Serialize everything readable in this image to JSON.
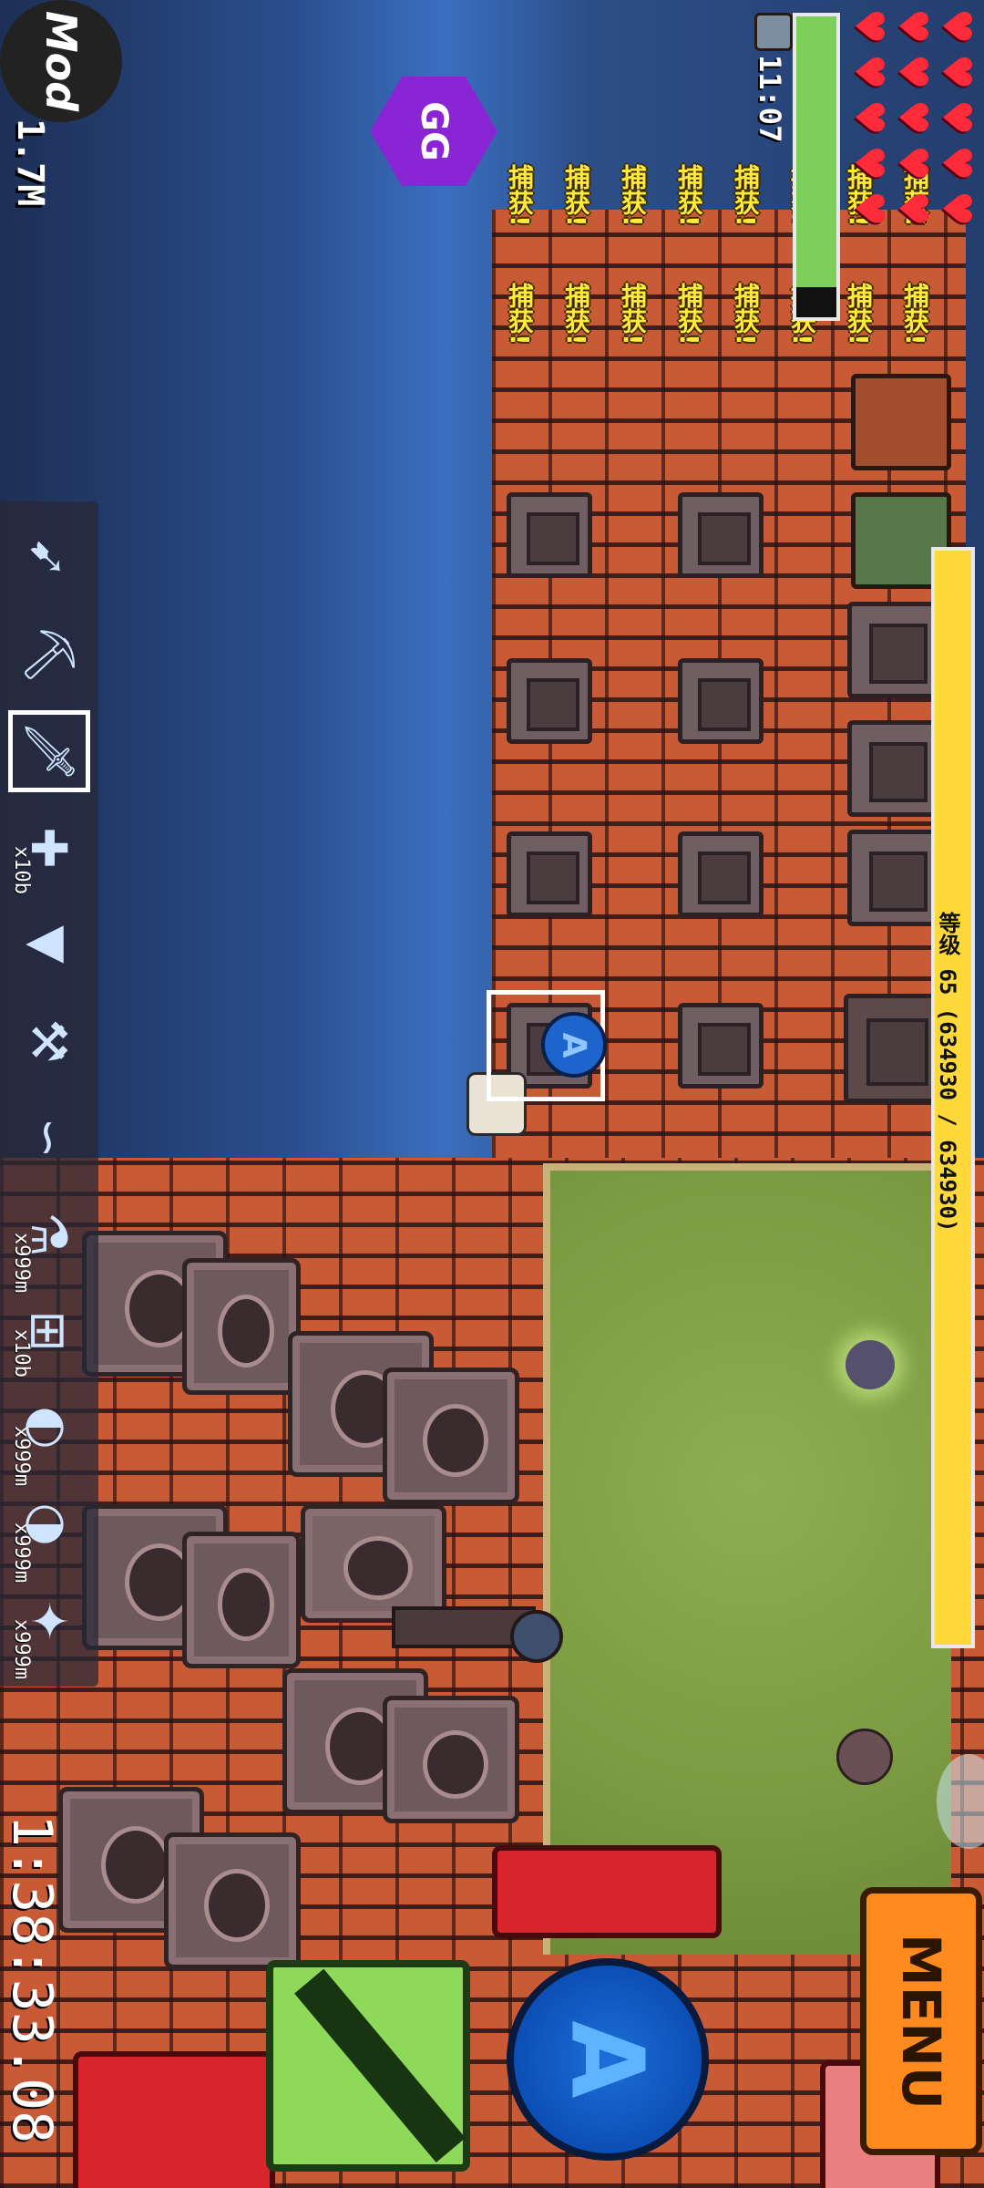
{
  "hud": {
    "mod_badge": "Mod",
    "money": "1.7M",
    "clock": "11:07",
    "timer": "1:38:33.08",
    "level_text": "等级 65 (634930 / 634930)",
    "hp_fraction": 0.9,
    "level_fraction": 1.0
  },
  "hearts": {
    "count": 15,
    "symbol": "♥"
  },
  "notices": {
    "text": "捕获!",
    "columns": [
      {
        "items": [
          "捕获!",
          "捕获!"
        ]
      },
      {
        "items": [
          "捕获!",
          "捕获!"
        ]
      },
      {
        "items": [
          "捕获!",
          "捕获!"
        ]
      },
      {
        "items": [
          "捕获!",
          "捕获!"
        ]
      },
      {
        "items": [
          "捕获!",
          "捕获!"
        ]
      },
      {
        "items": [
          "捕获!",
          "捕获!"
        ]
      },
      {
        "items": [
          "捕获!",
          "捕获!"
        ]
      },
      {
        "items": [
          "捕获!",
          "捕获!"
        ]
      }
    ]
  },
  "toolbar": {
    "items": [
      {
        "icon": "bow-icon",
        "glyph": "➹",
        "count": ""
      },
      {
        "icon": "shovel-icon",
        "glyph": "⛏",
        "count": ""
      },
      {
        "icon": "sword-icon",
        "glyph": "🗡",
        "count": "",
        "selected": true
      },
      {
        "icon": "crossbow-icon",
        "glyph": "✚",
        "count": "x10b"
      },
      {
        "icon": "drill-icon",
        "glyph": "▼",
        "count": ""
      },
      {
        "icon": "hammer-icon",
        "glyph": "⚒",
        "count": ""
      },
      {
        "icon": "fishing-rod-icon",
        "glyph": "∽",
        "count": ""
      },
      {
        "icon": "potion-icon",
        "glyph": "⚗",
        "count": "x999m"
      },
      {
        "icon": "trap-icon",
        "glyph": "⊞",
        "count": "x10b"
      },
      {
        "icon": "bread-icon",
        "glyph": "◐",
        "count": "x999m"
      },
      {
        "icon": "cookie-icon",
        "glyph": "◑",
        "count": "x999m"
      },
      {
        "icon": "star-food-icon",
        "glyph": "✦",
        "count": "x999m"
      }
    ]
  },
  "buttons": {
    "menu": "MENU",
    "action": "A",
    "gg": "GG",
    "small_action": "A"
  },
  "colors": {
    "heart": "#ff2a3a",
    "hp": "#7ccf5a",
    "level": "#ffd93b",
    "notice": "#ffea3a",
    "menu": "#ff8a1e",
    "action": "#0c4fb5"
  }
}
